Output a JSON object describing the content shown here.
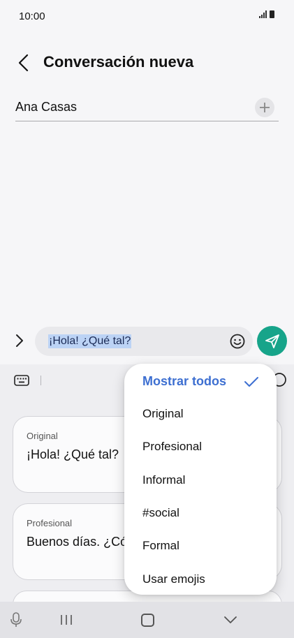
{
  "status_bar": {
    "time": "10:00",
    "icons": [
      "signal-icon",
      "battery-icon"
    ]
  },
  "header": {
    "back_icon": "chevron-left-icon",
    "title": "Conversación nueva"
  },
  "recipient": {
    "name": "Ana Casas",
    "add_icon": "plus-icon"
  },
  "composer": {
    "expand_icon": "chevron-right-icon",
    "message": "¡Hola! ¿Qué tal?",
    "emoji_icon": "smiley-icon",
    "send_icon": "send-icon",
    "send_color": "#17a48a"
  },
  "suggestions_panel": {
    "keyboard_icon": "keyboard-icon",
    "cards": [
      {
        "label": "Original",
        "text": "¡Hola! ¿Qué tal?"
      },
      {
        "label": "Profesional",
        "text": "Buenos días. ¿Có"
      }
    ]
  },
  "style_menu": {
    "selected": "Mostrar todos",
    "selected_color": "#3d6fd1",
    "check_icon": "check-icon",
    "options": [
      "Original",
      "Profesional",
      "Informal",
      "#social",
      "Formal",
      "Usar emojis"
    ]
  },
  "nav_bar": {
    "icons": [
      "mic-icon",
      "recent-apps-icon",
      "home-icon",
      "back-icon"
    ]
  }
}
